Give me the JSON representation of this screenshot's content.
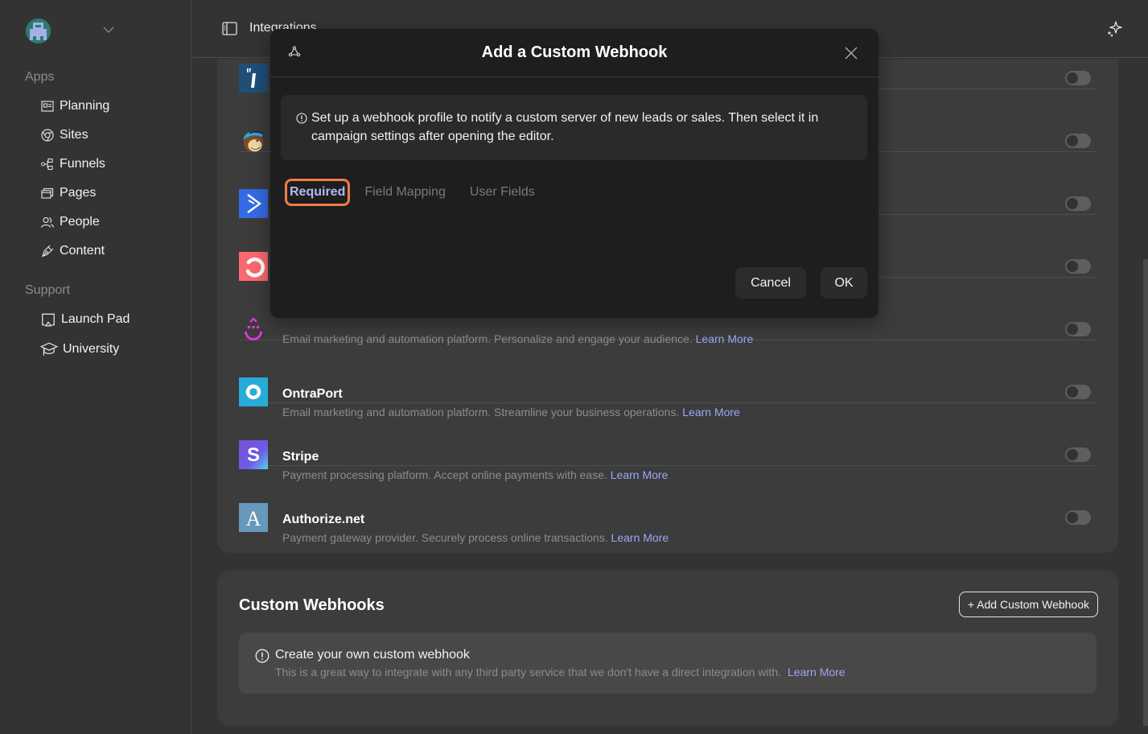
{
  "sidebar": {
    "sections": [
      {
        "label": "Apps",
        "items": [
          {
            "label": "Planning",
            "icon": "planning-icon"
          },
          {
            "label": "Sites",
            "icon": "sites-icon"
          },
          {
            "label": "Funnels",
            "icon": "funnels-icon"
          },
          {
            "label": "Pages",
            "icon": "pages-icon"
          },
          {
            "label": "People",
            "icon": "people-icon"
          },
          {
            "label": "Content",
            "icon": "content-icon"
          }
        ]
      },
      {
        "label": "Support",
        "items": [
          {
            "label": "Launch Pad",
            "icon": "launch-pad-icon"
          },
          {
            "label": "University",
            "icon": "university-icon"
          }
        ]
      }
    ]
  },
  "header": {
    "title": "Integrations"
  },
  "integrations": [
    {
      "logo": "infusionsoft-logo",
      "logo_color": "#1f4e79",
      "name": "",
      "description": "",
      "learn_more": "",
      "enabled": false
    },
    {
      "logo": "mailchimp-logo",
      "logo_color": "#f0d6a0",
      "name": "",
      "description": "",
      "learn_more": "",
      "enabled": false
    },
    {
      "logo": "activecampaign-logo",
      "logo_color": "#356ae6",
      "name": "",
      "description": "",
      "learn_more": "",
      "enabled": false
    },
    {
      "logo": "convertkit-logo",
      "logo_color": "#fb6970",
      "name": "",
      "description": "",
      "learn_more": "",
      "enabled": false
    },
    {
      "logo": "drip-logo",
      "logo_color": "#e834e8",
      "name": "",
      "description": "Email marketing and automation platform. Personalize and engage your audience.",
      "learn_more": "Learn More",
      "enabled": false
    },
    {
      "logo": "ontraport-logo",
      "logo_color": "#27acd9",
      "name": "OntraPort",
      "description": "Email marketing and automation platform. Streamline your business operations.",
      "learn_more": "Learn More",
      "enabled": false
    },
    {
      "logo": "stripe-logo",
      "logo_color": "#6b5ce7",
      "name": "Stripe",
      "description": "Payment processing platform. Accept online payments with ease.",
      "learn_more": "Learn More",
      "enabled": false
    },
    {
      "logo": "authorize-net-logo",
      "logo_color": "#6699bb",
      "name": "Authorize.net",
      "description": "Payment gateway provider. Securely process online transactions.",
      "learn_more": "Learn More",
      "enabled": false
    }
  ],
  "custom_webhooks": {
    "title": "Custom Webhooks",
    "add_button": "+ Add Custom Webhook",
    "info_title": "Create your own custom webhook",
    "info_desc": "This is a great way to integrate with any third party service that we don't have a direct integration with.",
    "learn_more": "Learn More"
  },
  "modal": {
    "title": "Add a Custom Webhook",
    "info": "Set up a webhook profile to notify a custom server of new leads or sales. Then select it in campaign settings after opening the editor.",
    "tabs": [
      {
        "label": "Required",
        "active": true
      },
      {
        "label": "Field Mapping",
        "active": false
      },
      {
        "label": "User Fields",
        "active": false
      }
    ],
    "cancel_label": "Cancel",
    "ok_label": "OK"
  },
  "colors": {
    "accent": "#b4b9f5",
    "link": "#9ea5f7",
    "focus_ring": "#f07a4a"
  }
}
